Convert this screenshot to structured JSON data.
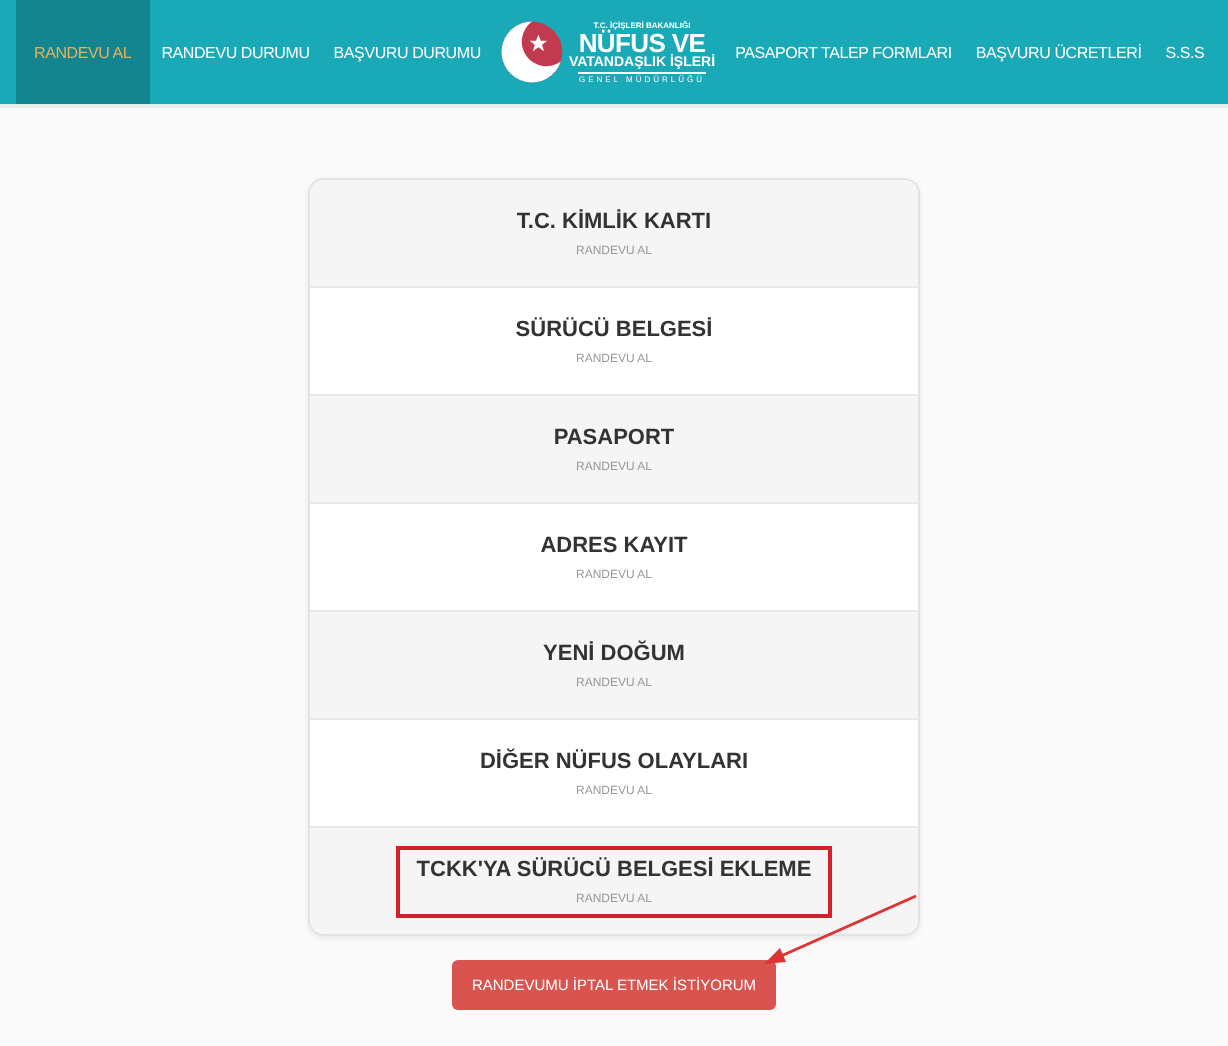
{
  "nav_left": [
    {
      "label": "RANDEVU AL",
      "selected": true
    },
    {
      "label": "RANDEVU DURUMU",
      "selected": false
    },
    {
      "label": "BAŞVURU DURUMU",
      "selected": false
    }
  ],
  "logo": {
    "ministry": "T.C. İÇİŞLERİ BAKANLIĞI",
    "line_1": "NÜFUS VE",
    "line_2": "VATANDAŞLIK İŞLERİ",
    "line_3": "GENEL MÜDÜRLÜĞÜ"
  },
  "nav_right": [
    {
      "label": "PASAPORT TALEP FORMLARI",
      "selected": false
    },
    {
      "label": "BAŞVURU ÜCRETLERİ",
      "selected": false
    },
    {
      "label": "S.S.S",
      "selected": false
    }
  ],
  "services": [
    {
      "title": "T.C. KİMLİK KARTI",
      "action": "RANDEVU AL",
      "highlighted": false
    },
    {
      "title": "SÜRÜCÜ BELGESİ",
      "action": "RANDEVU AL",
      "highlighted": false
    },
    {
      "title": "PASAPORT",
      "action": "RANDEVU AL",
      "highlighted": false
    },
    {
      "title": "ADRES KAYIT",
      "action": "RANDEVU AL",
      "highlighted": false
    },
    {
      "title": "YENİ DOĞUM",
      "action": "RANDEVU AL",
      "highlighted": false
    },
    {
      "title": "DİĞER NÜFUS OLAYLARI",
      "action": "RANDEVU AL",
      "highlighted": false
    },
    {
      "title": "TCKK'YA SÜRÜCÜ BELGESİ EKLEME",
      "action": "RANDEVU AL",
      "highlighted": true
    }
  ],
  "cancel_button": "RANDEVUMU İPTAL ETMEK İSTİYORUM"
}
